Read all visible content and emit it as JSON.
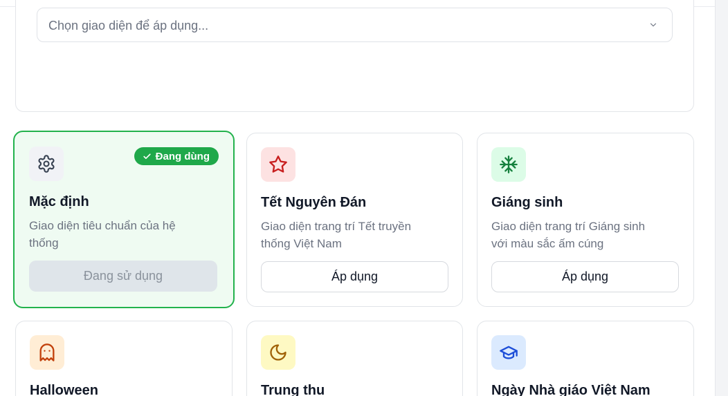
{
  "selector": {
    "placeholder": "Chọn giao diện để áp dụng..."
  },
  "themes": [
    {
      "name": "Mặc định",
      "description": "Giao diện tiêu chuẩn của hệ thống",
      "icon": "gear-icon",
      "icon_bg": "#f1f2f6",
      "icon_color": "#374151",
      "status": "active",
      "badge": "Đang dùng",
      "button": "Đang sử dụng"
    },
    {
      "name": "Tết Nguyên Đán",
      "description": "Giao diện trang trí Tết truyền thống Việt Nam",
      "icon": "star-icon",
      "icon_bg": "#fde2e2",
      "icon_color": "#c81e1e",
      "button": "Áp dụng"
    },
    {
      "name": "Giáng sinh",
      "description": "Giao diện trang trí Giáng sinh với màu sắc ấm cúng",
      "icon": "snowflake-icon",
      "icon_bg": "#dcfce7",
      "icon_color": "#15803d",
      "button": "Áp dụng"
    },
    {
      "name": "Halloween",
      "icon": "ghost-icon",
      "icon_bg": "#ffedd5",
      "icon_color": "#c2410c"
    },
    {
      "name": "Trung thu",
      "icon": "moon-icon",
      "icon_bg": "#fef9c3",
      "icon_color": "#a16207"
    },
    {
      "name": "Ngày Nhà giáo Việt Nam",
      "icon": "graduation-cap-icon",
      "icon_bg": "#dbeafe",
      "icon_color": "#1d4ed8"
    }
  ],
  "colors": {
    "active_border": "#22b24c",
    "active_bg": "#effbf2",
    "badge_bg": "#1fa84a"
  }
}
